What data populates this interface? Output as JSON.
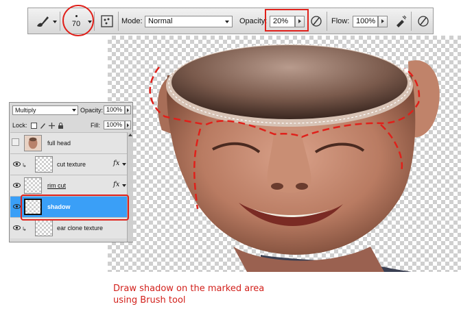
{
  "options_bar": {
    "brush_size": "70",
    "mode_label": "Mode:",
    "mode_value": "Normal",
    "opacity_label": "Opacity:",
    "opacity_value": "20%",
    "flow_label": "Flow:",
    "flow_value": "100%"
  },
  "layers_panel": {
    "blend_mode": "Multiply",
    "opacity_label": "Opacity:",
    "opacity_value": "100%",
    "lock_label": "Lock:",
    "fill_label": "Fill:",
    "fill_value": "100%",
    "layers": [
      {
        "name": "full head",
        "visible": false,
        "has_fx": false
      },
      {
        "name": "cut texture",
        "visible": true,
        "has_fx": true
      },
      {
        "name": "rim cut",
        "visible": true,
        "has_fx": true
      },
      {
        "name": "shadow",
        "visible": true,
        "has_fx": false,
        "selected": true
      },
      {
        "name": "ear clone texture",
        "visible": true,
        "has_fx": false
      }
    ]
  },
  "caption": {
    "line1": "Draw shadow on the marked area",
    "line2": "using Brush tool"
  },
  "colors": {
    "annotation": "#e0201a",
    "selection": "#3a9ff7"
  }
}
